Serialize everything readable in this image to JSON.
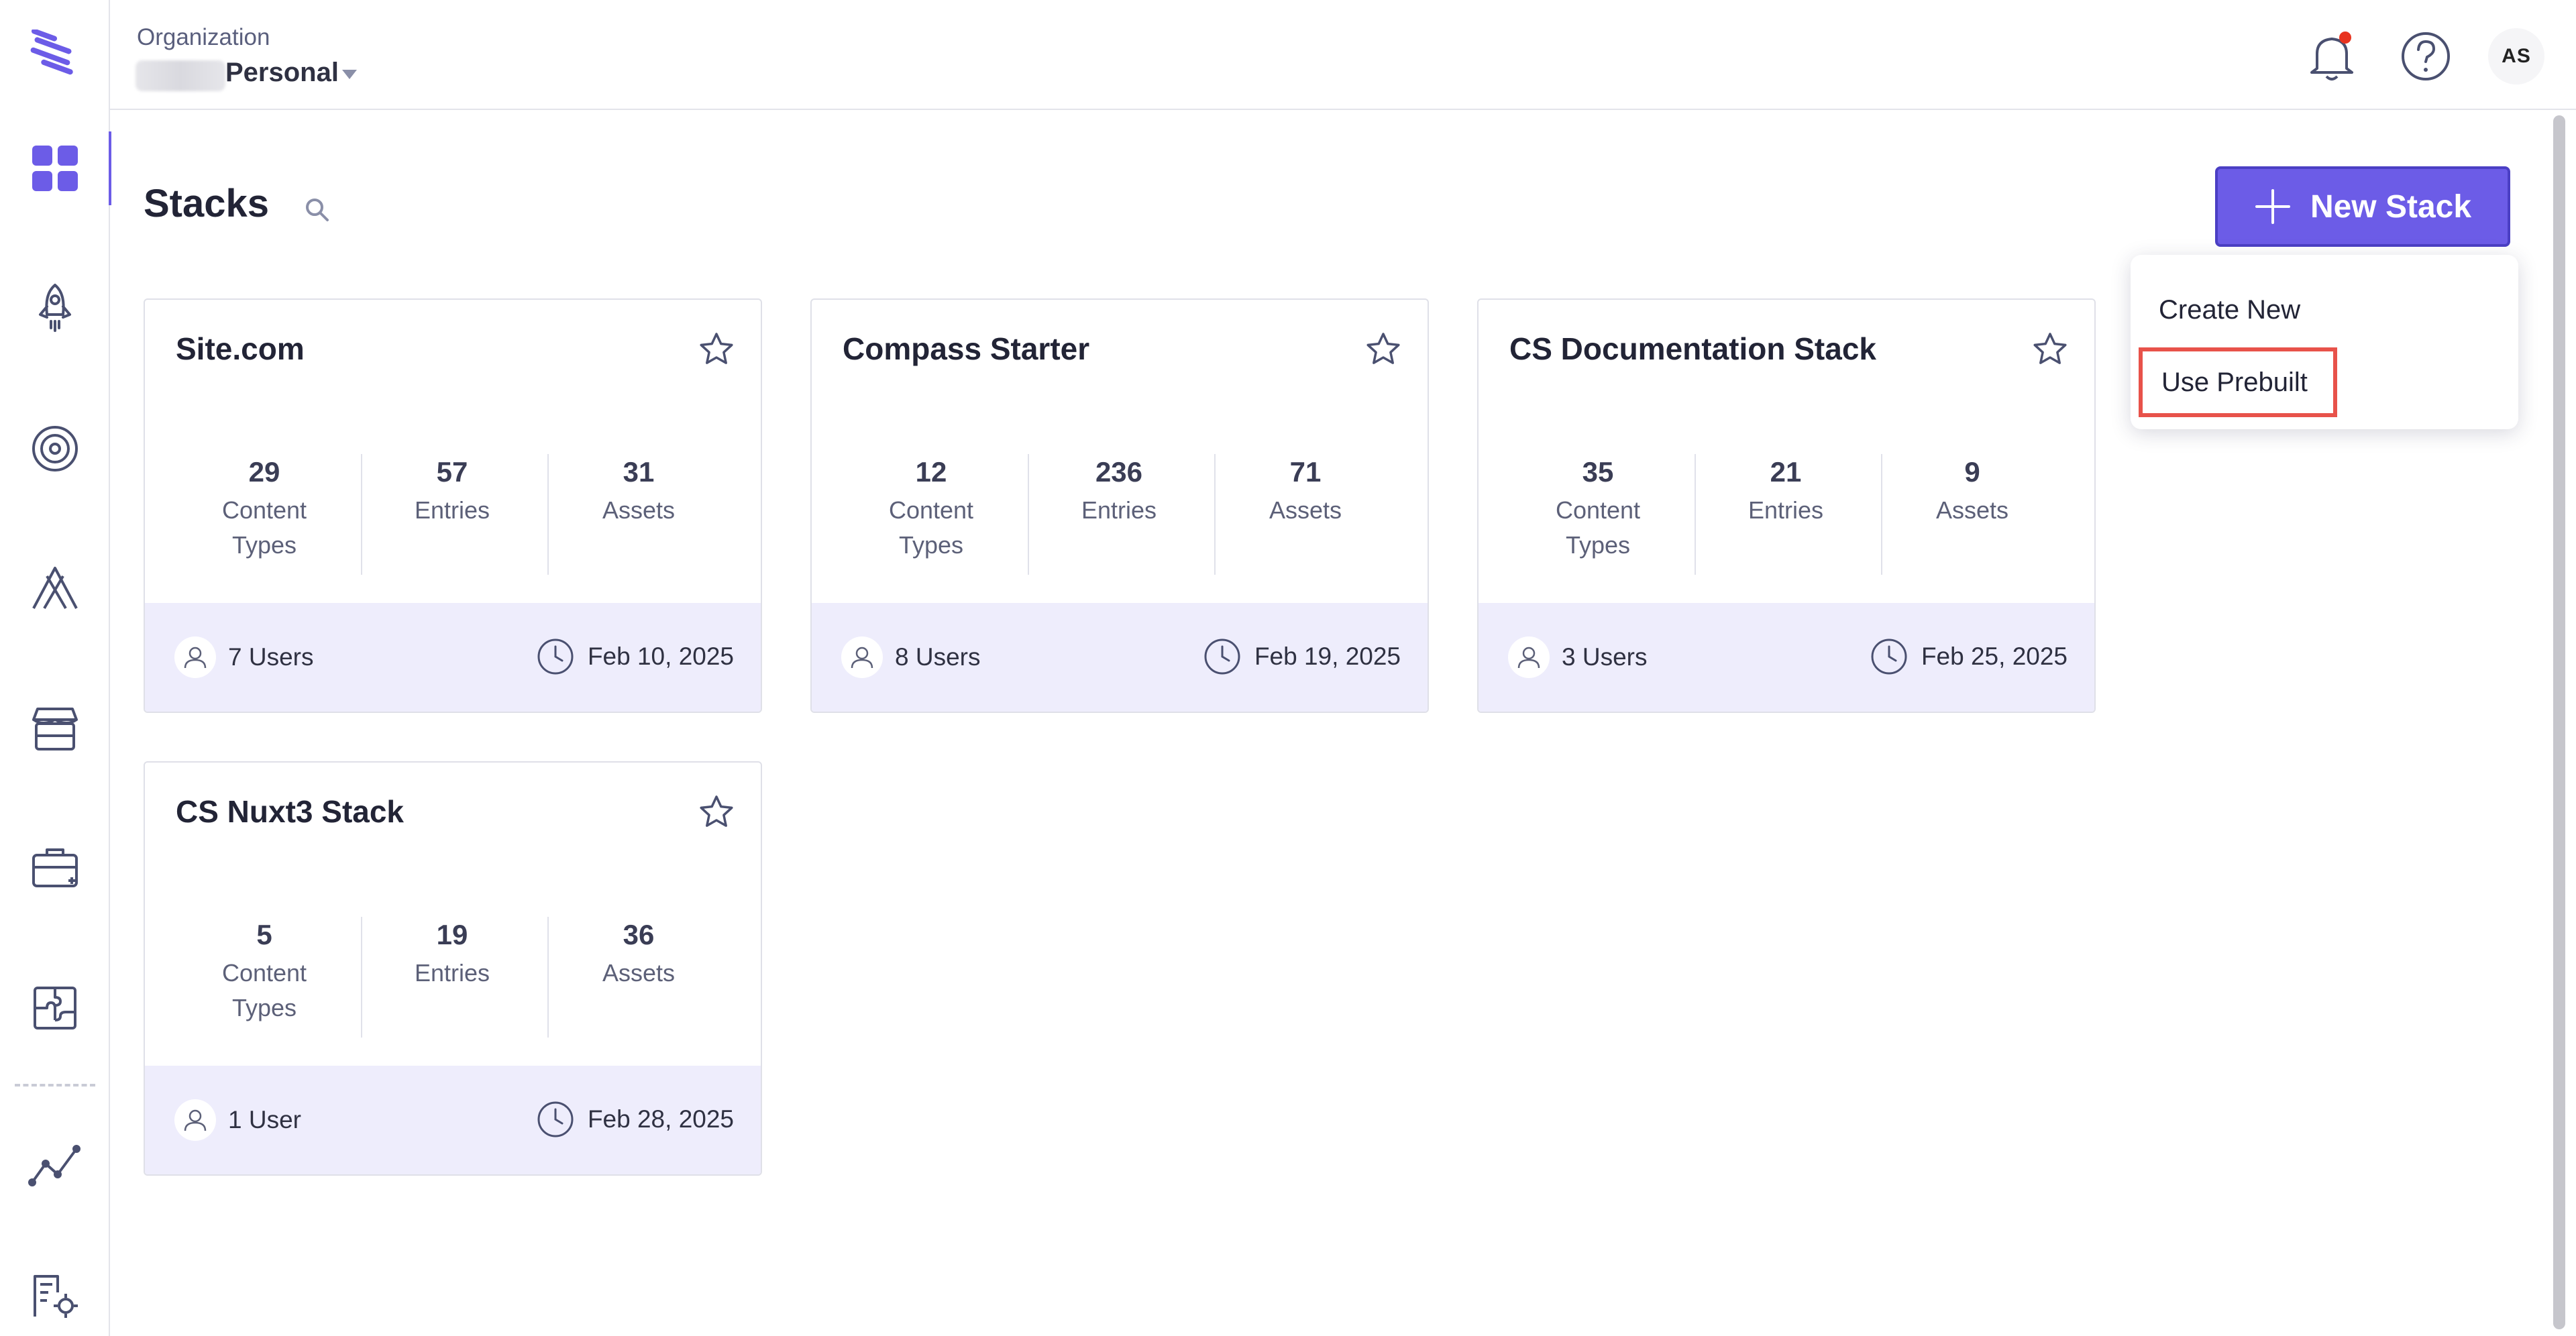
{
  "header": {
    "org_label": "Organization",
    "org_name": "Personal",
    "avatar_initials": "AS",
    "notification_dot_color": "#e8331f"
  },
  "rail": {
    "items": [
      {
        "icon": "grid-icon",
        "active": true
      },
      {
        "icon": "rocket-icon"
      },
      {
        "icon": "target-icon"
      },
      {
        "icon": "automate-icon"
      },
      {
        "icon": "marketplace-icon"
      },
      {
        "icon": "briefcase-icon"
      },
      {
        "icon": "puzzle-icon"
      },
      {
        "icon": "analytics-icon"
      },
      {
        "icon": "org-settings-icon"
      }
    ]
  },
  "main": {
    "title": "Stacks",
    "new_stack_label": "New Stack",
    "accent_color": "#6c5ce7"
  },
  "dropdown": {
    "create_new": "Create New",
    "use_prebuilt": "Use Prebuilt"
  },
  "cards": [
    {
      "name": "Site.com",
      "content_types": "29",
      "entries": "57",
      "assets": "31",
      "users": "7 Users",
      "date": "Feb 10, 2025"
    },
    {
      "name": "Compass Starter",
      "content_types": "12",
      "entries": "236",
      "assets": "71",
      "users": "8 Users",
      "date": "Feb 19, 2025"
    },
    {
      "name": "CS Documentation Stack",
      "content_types": "35",
      "entries": "21",
      "assets": "9",
      "users": "3 Users",
      "date": "Feb 25, 2025"
    },
    {
      "name": "CS Nuxt3 Stack",
      "content_types": "5",
      "entries": "19",
      "assets": "36",
      "users": "1 User",
      "date": "Feb 28, 2025"
    }
  ],
  "labels": {
    "content": "Content",
    "types": "Types",
    "entries": "Entries",
    "assets": "Assets"
  }
}
